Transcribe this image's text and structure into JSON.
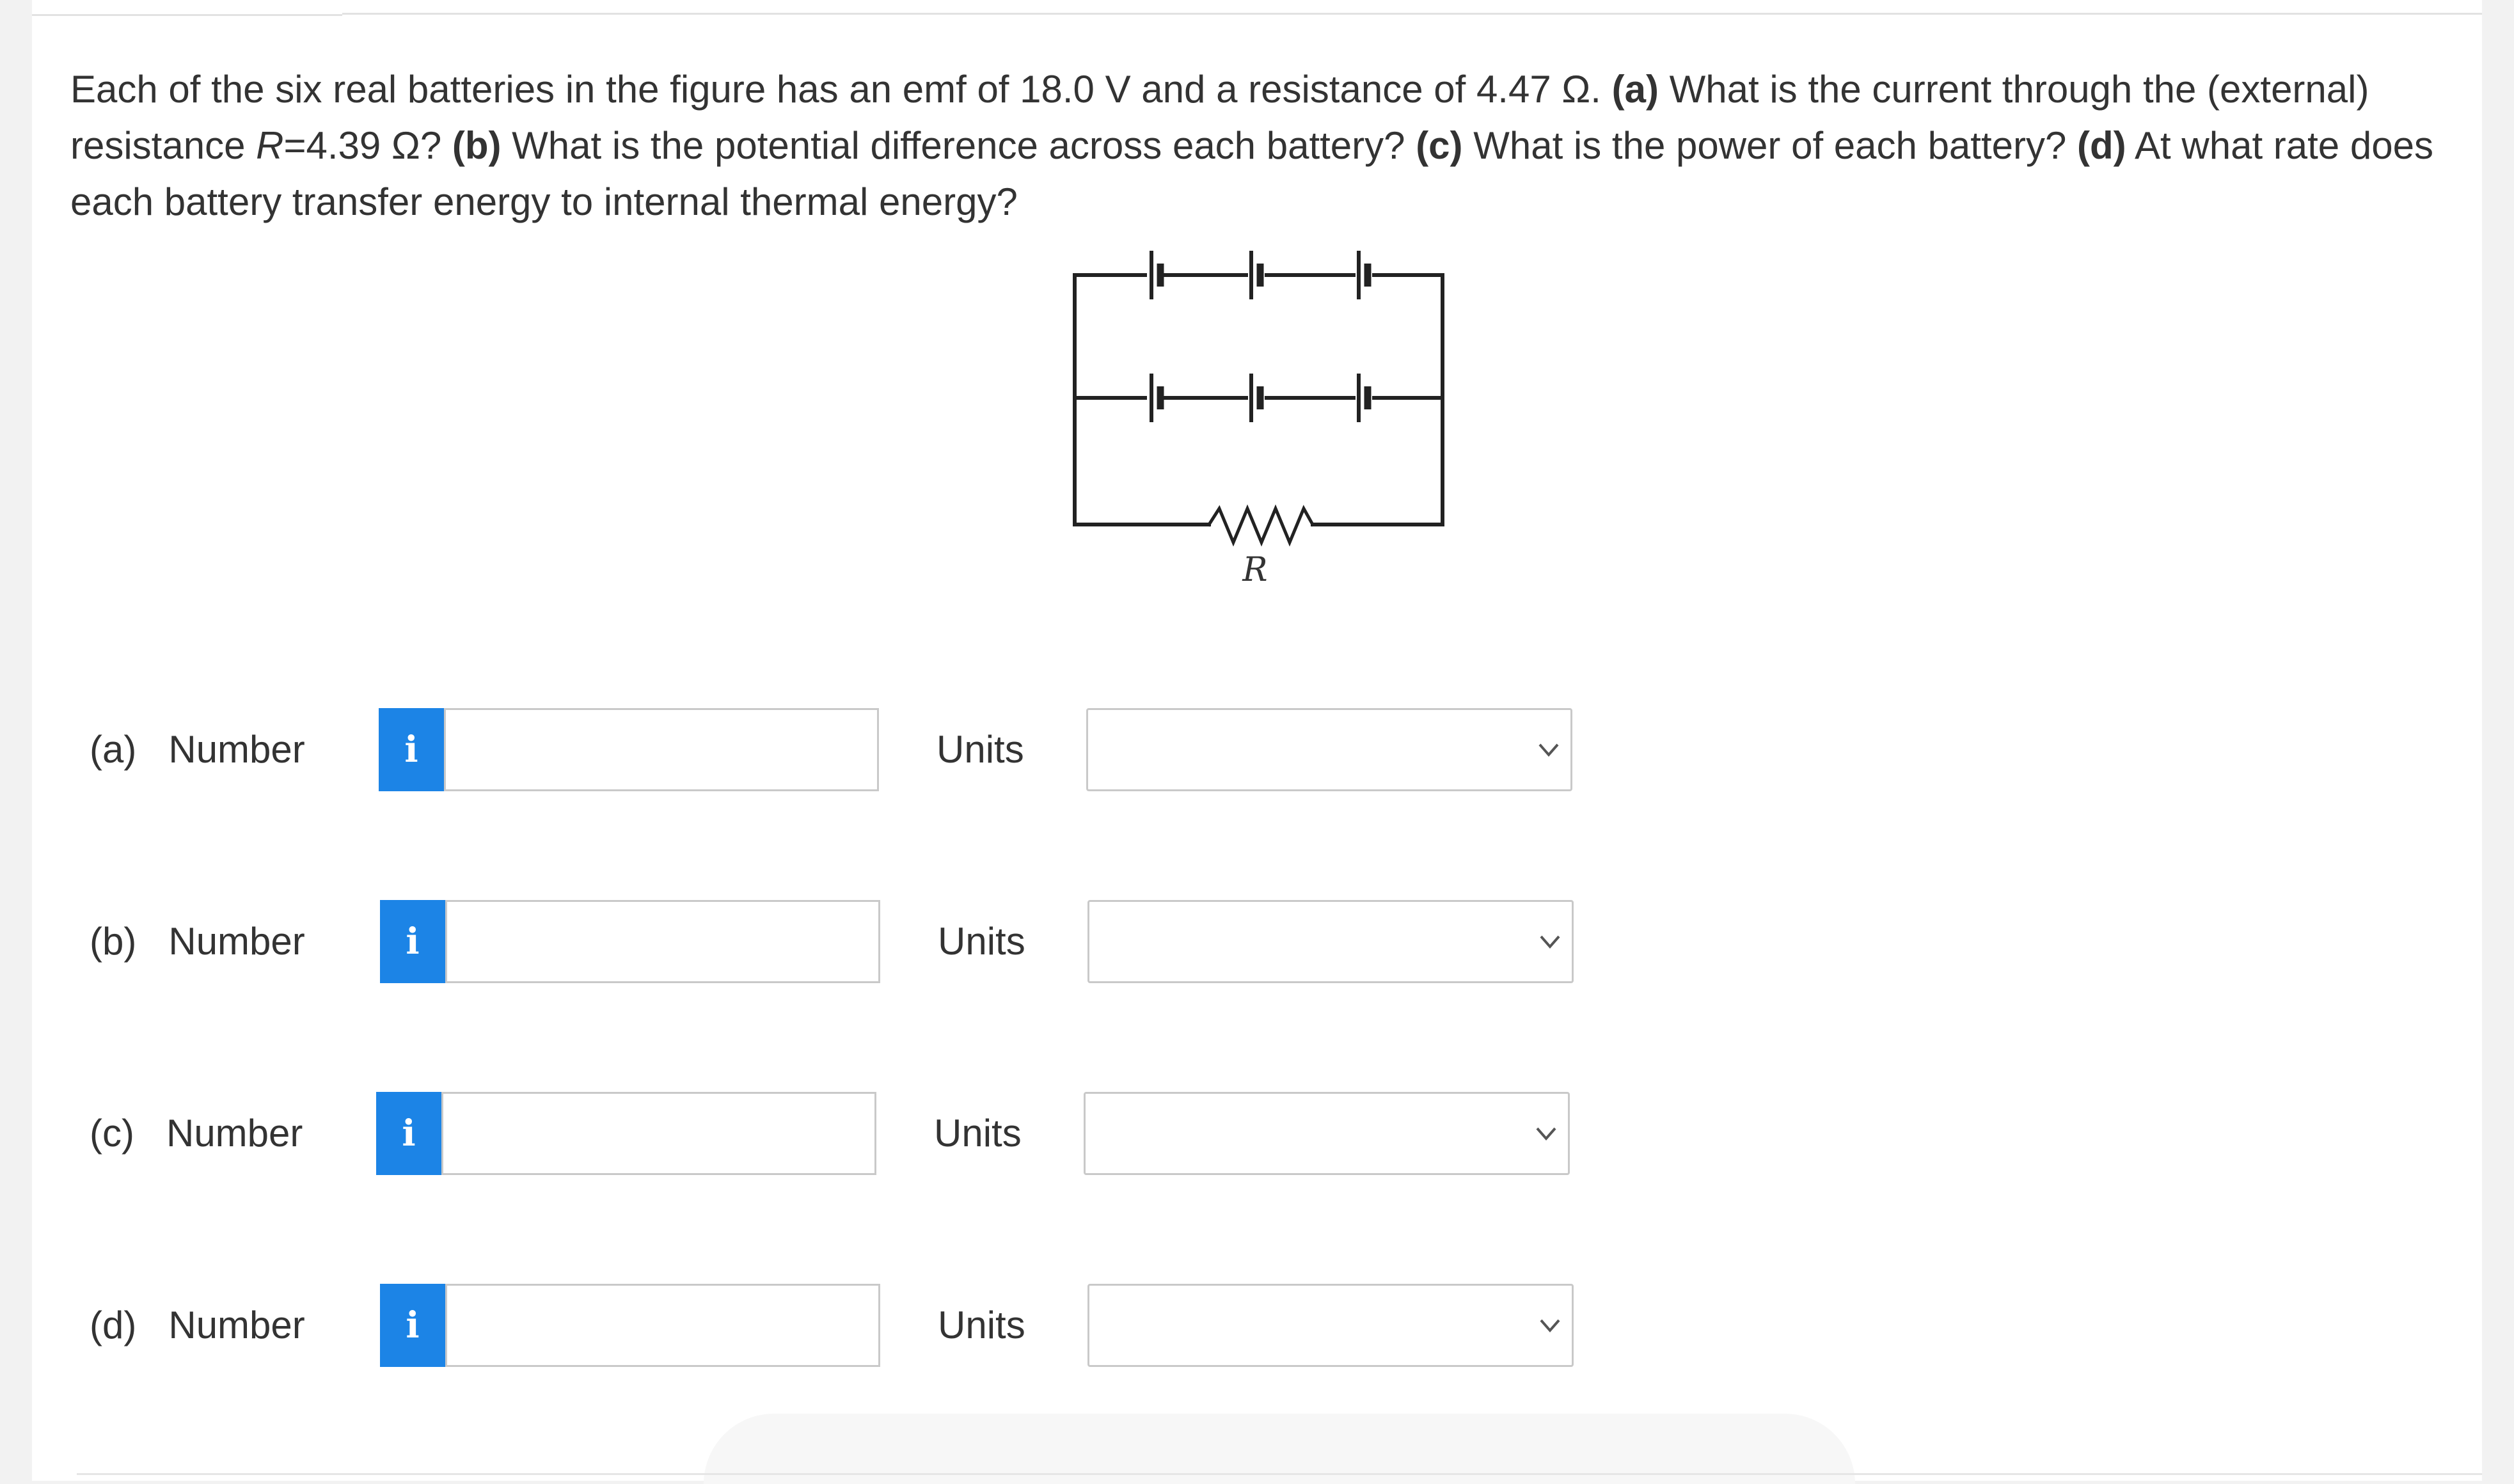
{
  "question": {
    "intro": "Each of the six real batteries in the figure has an emf of 18.0 V and a resistance of 4.47 Ω. ",
    "a_tag": "(a)",
    "a_text_1": " What is the current through the (external) resistance ",
    "a_var": "R",
    "a_text_2": "=4.39 Ω? ",
    "b_tag": "(b)",
    "b_text": " What is the potential difference across each battery? ",
    "c_tag": "(c)",
    "c_text": " What is the power of each battery? ",
    "d_tag": "(d)",
    "d_text": " At what rate does each battery transfer energy to internal thermal energy?"
  },
  "figure": {
    "resistor_label": "R"
  },
  "parts": [
    {
      "tag": "(a)",
      "number_label": "Number",
      "info_glyph": "i",
      "value": "",
      "units_label": "Units",
      "units_value": ""
    },
    {
      "tag": "(b)",
      "number_label": "Number",
      "info_glyph": "i",
      "value": "",
      "units_label": "Units",
      "units_value": ""
    },
    {
      "tag": "(c)",
      "number_label": "Number",
      "info_glyph": "i",
      "value": "",
      "units_label": "Units",
      "units_value": ""
    },
    {
      "tag": "(d)",
      "number_label": "Number",
      "info_glyph": "i",
      "value": "",
      "units_label": "Units",
      "units_value": ""
    }
  ],
  "colors": {
    "info_button": "#1c84e6",
    "text": "#333333",
    "border": "#c9c9c9"
  },
  "icons": {
    "info": "info-icon",
    "dropdown": "chevron-down-icon"
  }
}
